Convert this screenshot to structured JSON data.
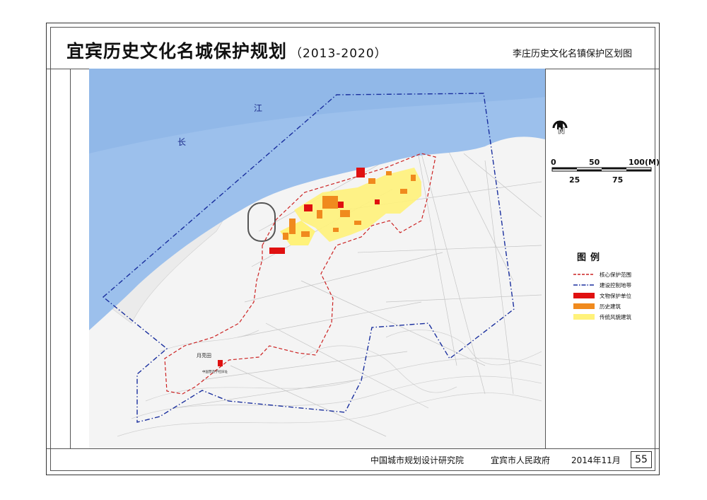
{
  "header": {
    "title": "宜宾历史文化名城保护规划",
    "years": "（2013-2020）",
    "subtitle": "李庄历史文化名镇保护区划图"
  },
  "map": {
    "river_char_1": "长",
    "river_char_2": "江",
    "place_label": "月亮田",
    "site_label": "中国营造学社旧址",
    "colors": {
      "river": "#9cc0ec",
      "core_boundary": "#cc2222",
      "control_boundary": "#1a2f9e",
      "relic": "#e01010",
      "historic": "#f08a1e",
      "traditional": "#fff27a"
    }
  },
  "north": {
    "letter": "N"
  },
  "scale": {
    "top_labels": [
      "0",
      "50",
      "100(M)"
    ],
    "bottom_labels": [
      "25",
      "75"
    ]
  },
  "legend": {
    "title": "图例",
    "items": [
      {
        "label": "核心保护范围",
        "style": "dashed",
        "color": "#cc2222"
      },
      {
        "label": "建设控制地带",
        "style": "dashdot",
        "color": "#1a2f9e"
      },
      {
        "label": "文物保护单位",
        "style": "fill",
        "color": "#e01010"
      },
      {
        "label": "历史建筑",
        "style": "fill",
        "color": "#f08a1e"
      },
      {
        "label": "传统风貌建筑",
        "style": "fill",
        "color": "#fff27a"
      }
    ]
  },
  "footer": {
    "org1": "中国城市规划设计研究院",
    "org2": "宜宾市人民政府",
    "date": "2014年11月",
    "page": "55"
  }
}
